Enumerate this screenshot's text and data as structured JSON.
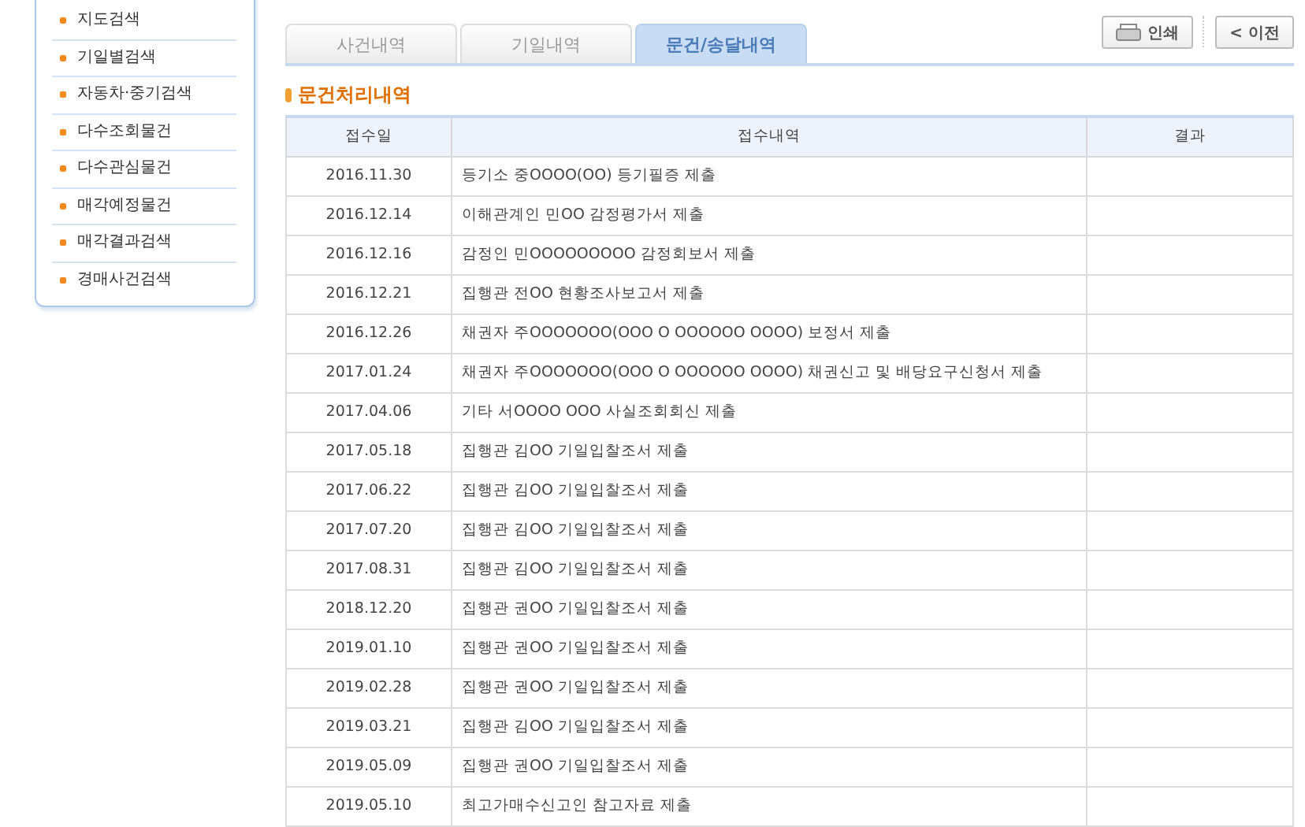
{
  "sidebar": {
    "items": [
      {
        "label": "지도검색",
        "selected": false
      },
      {
        "label": "기일별검색",
        "selected": false
      },
      {
        "label": "자동차·중기검색",
        "selected": false
      },
      {
        "label": "다수조회물건",
        "selected": false
      },
      {
        "label": "다수관심물건",
        "selected": false
      },
      {
        "label": "매각예정물건",
        "selected": false
      },
      {
        "label": "매각결과검색",
        "selected": false
      },
      {
        "label": "경매사건검색",
        "selected": false
      }
    ]
  },
  "tabs": [
    {
      "label": "사건내역",
      "selected": false
    },
    {
      "label": "기일내역",
      "selected": false
    },
    {
      "label": "문건/송달내역",
      "selected": true
    }
  ],
  "toolbar": {
    "print": "인쇄",
    "back": "< 이전"
  },
  "section_title": "문건처리내역",
  "table": {
    "columns": [
      "접수일",
      "접수내역",
      "결과"
    ],
    "rows": [
      [
        "2016.11.30",
        "등기소 중OOOO(OO) 등기필증 제출",
        ""
      ],
      [
        "2016.12.14",
        "이해관계인 민OO 감정평가서 제출",
        ""
      ],
      [
        "2016.12.16",
        "감정인 민OOOOOOOOO 감정회보서 제출",
        ""
      ],
      [
        "2016.12.21",
        "집행관 전OO 현황조사보고서 제출",
        ""
      ],
      [
        "2016.12.26",
        "채권자 주OOOOOOO(OOO O OOOOOO OOOO) 보정서 제출",
        ""
      ],
      [
        "2017.01.24",
        "채권자 주OOOOOOO(OOO O OOOOOO OOOO) 채권신고 및 배당요구신청서 제출",
        ""
      ],
      [
        "2017.04.06",
        "기타 서OOOO OOO 사실조회회신 제출",
        ""
      ],
      [
        "2017.05.18",
        "집행관 김OO 기일입찰조서 제출",
        ""
      ],
      [
        "2017.06.22",
        "집행관 김OO 기일입찰조서 제출",
        ""
      ],
      [
        "2017.07.20",
        "집행관 김OO 기일입찰조서 제출",
        ""
      ],
      [
        "2017.08.31",
        "집행관 김OO 기일입찰조서 제출",
        ""
      ],
      [
        "2018.12.20",
        "집행관 권OO 기일입찰조서 제출",
        ""
      ],
      [
        "2019.01.10",
        "집행관 권OO 기일입찰조서 제출",
        ""
      ],
      [
        "2019.02.28",
        "집행관 권OO 기일입찰조서 제출",
        ""
      ],
      [
        "2019.03.21",
        "집행관 김OO 기일입찰조서 제출",
        ""
      ],
      [
        "2019.05.09",
        "집행관 권OO 기일입찰조서 제출",
        ""
      ],
      [
        "2019.05.10",
        "최고가매수신고인 참고자료 제출",
        ""
      ]
    ]
  }
}
